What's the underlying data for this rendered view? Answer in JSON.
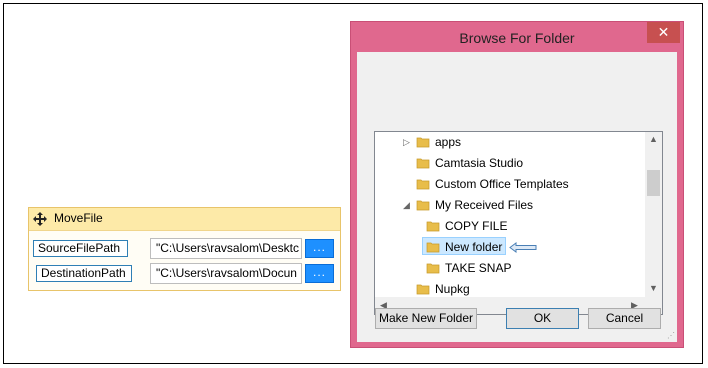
{
  "activity": {
    "title": "MoveFile",
    "args": [
      {
        "label": "SourceFilePath",
        "value": "\"C:\\Users\\ravsalom\\Desktc",
        "button": "..."
      },
      {
        "label": "DestinationPath",
        "value": "\"C:\\Users\\ravsalom\\Docun",
        "button": "..."
      }
    ]
  },
  "dialog": {
    "title": "Browse For Folder",
    "close": "✕",
    "tree": [
      {
        "label": "apps",
        "expander": "▷"
      },
      {
        "label": "Camtasia Studio",
        "expander": ""
      },
      {
        "label": "Custom Office Templates",
        "expander": ""
      },
      {
        "label": "My Received Files",
        "expander": "◢"
      },
      {
        "label": "COPY FILE",
        "expander": ""
      },
      {
        "label": "New folder",
        "expander": "",
        "selected": true
      },
      {
        "label": "TAKE SNAP",
        "expander": ""
      },
      {
        "label": "Nupkg",
        "expander": ""
      }
    ],
    "buttons": {
      "make_new_folder": "Make New Folder",
      "ok": "OK",
      "cancel": "Cancel"
    }
  },
  "colors": {
    "dialog_border": "#e0688e",
    "selection": "#cce8ff",
    "dots_button": "#1e90ff",
    "activity_header": "#fdeaa8"
  }
}
